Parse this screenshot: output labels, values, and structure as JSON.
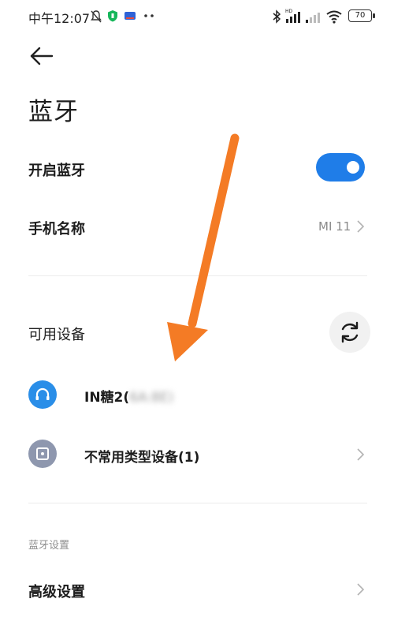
{
  "status_bar": {
    "time": "中午12:07",
    "battery": "70"
  },
  "header": {
    "title": "蓝牙"
  },
  "bluetooth_toggle": {
    "label": "开启蓝牙",
    "enabled": true
  },
  "device_name": {
    "label": "手机名称",
    "value": "MI 11"
  },
  "available": {
    "section_label": "可用设备",
    "devices": [
      {
        "name": "IN糖2(",
        "address_blurred": "6A:8E)",
        "icon": "headphones-icon",
        "icon_color": "#2a8ee8"
      },
      {
        "name": "不常用类型设备(1)",
        "icon": "device-square-icon",
        "icon_color": "#8e97ae"
      }
    ]
  },
  "settings_section": {
    "label": "蓝牙设置",
    "advanced_label": "高级设置"
  },
  "colors": {
    "accent": "#1f7de8",
    "annotation_arrow": "#f47b25"
  }
}
